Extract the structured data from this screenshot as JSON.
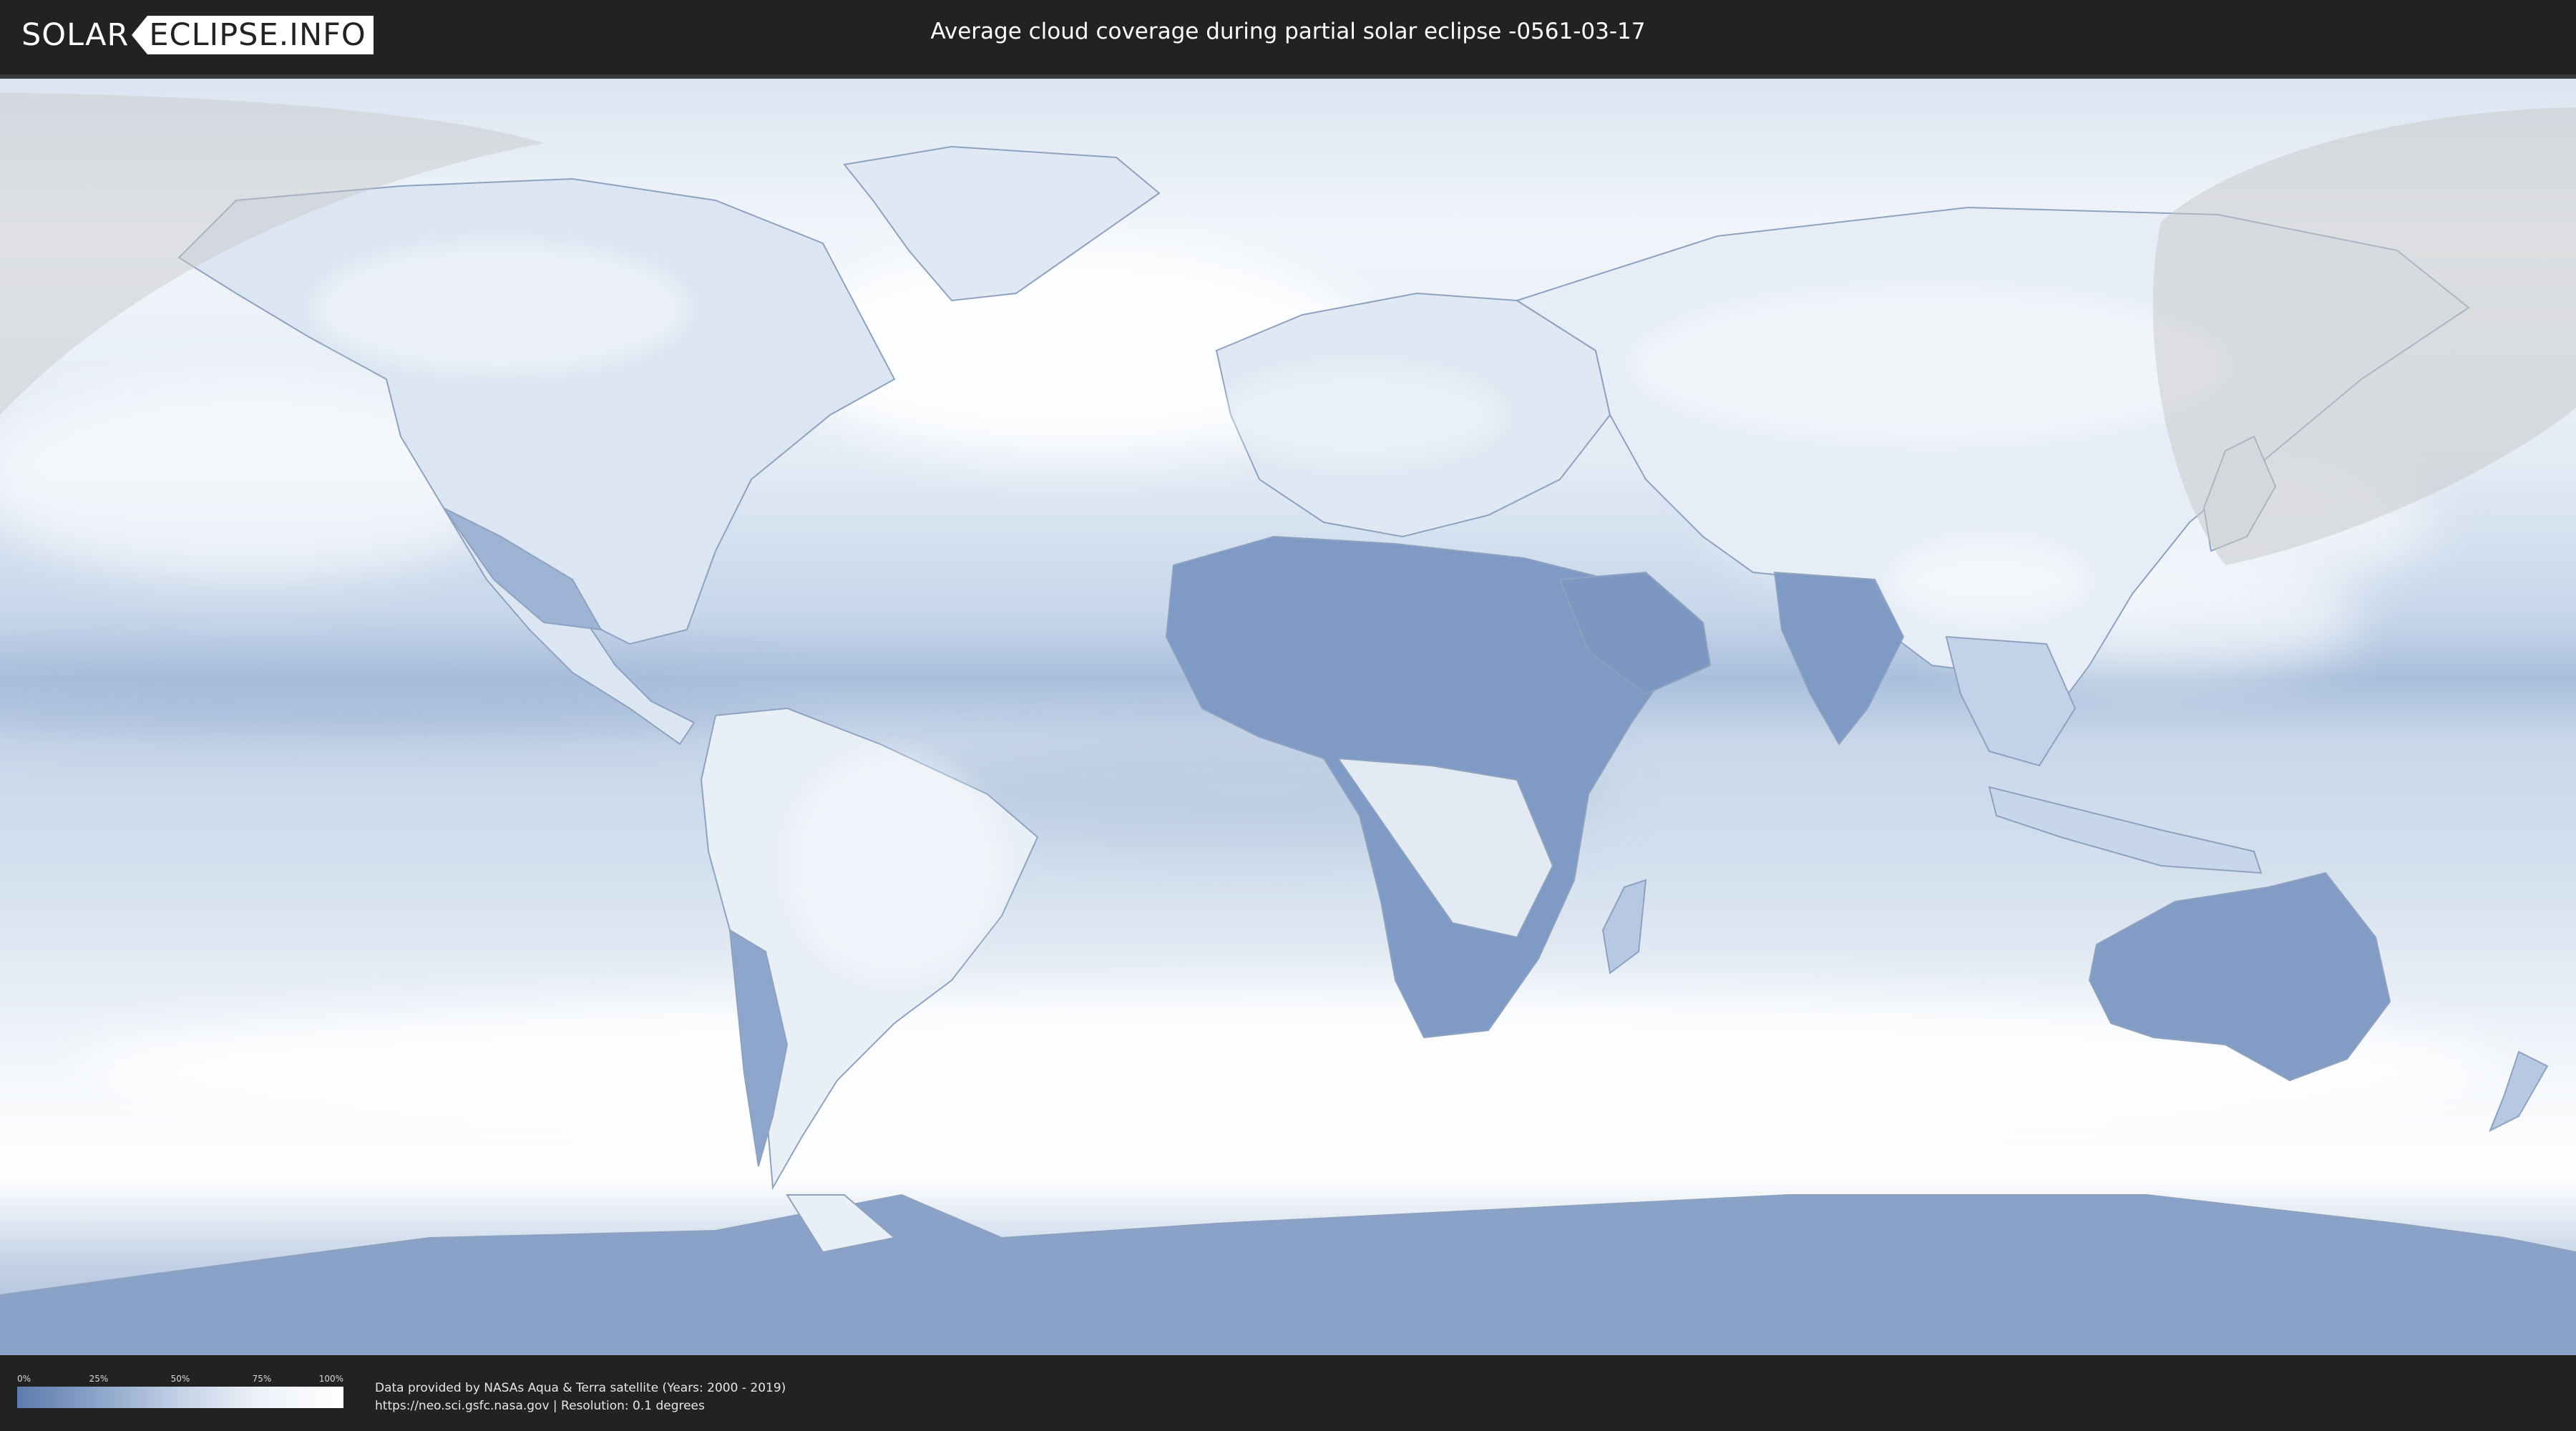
{
  "header": {
    "logo_left": "SOLAR",
    "logo_right": "ECLIPSE.INFO",
    "title": "Average cloud coverage during partial solar eclipse -0561-03-17"
  },
  "map": {
    "type": "equirectangular world cloud-coverage map",
    "colors": {
      "clear": "#5c7cad",
      "cloudy": "#ffffff",
      "eclipse_overlay": "#c8c8c8",
      "borders": "#6f84a3"
    },
    "eclipse_shadow_regions": [
      "north-west (Alaska / Pacific)",
      "north-east (East Asia / Siberia)"
    ]
  },
  "legend": {
    "ticks": [
      "0%",
      "25%",
      "50%",
      "75%",
      "100%"
    ]
  },
  "credits": {
    "line1": "Data provided by NASAs Aqua & Terra satellite (Years: 2000 - 2019)",
    "line2": "https://neo.sci.gsfc.nasa.gov | Resolution: 0.1 degrees"
  }
}
